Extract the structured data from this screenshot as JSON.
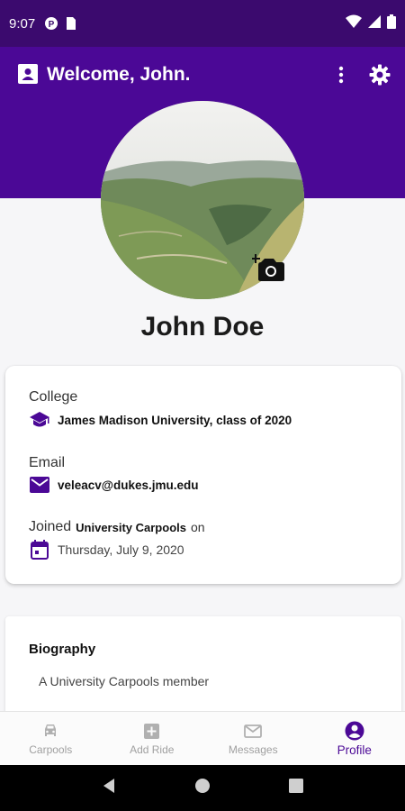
{
  "status_bar": {
    "time": "9:07",
    "icons": [
      "notification-icon",
      "sim-icon",
      "wifi-icon",
      "signal-icon",
      "battery-icon"
    ]
  },
  "header": {
    "title": "Welcome, John.",
    "left_icon": "contact-card-icon",
    "actions": [
      "more-vert-icon",
      "settings-icon"
    ]
  },
  "profile": {
    "name": "John Doe",
    "avatar_icon": "profile-photo",
    "camera_icon": "add-photo-icon"
  },
  "info": {
    "college_label": "College",
    "college_value": "James Madison University, class of 2020",
    "email_label": "Email",
    "email_value": "veleacv@dukes.jmu.edu",
    "joined_prefix": "Joined",
    "joined_org": "University Carpools",
    "joined_suffix": "on",
    "joined_date": "Thursday, July 9, 2020"
  },
  "biography": {
    "title": "Biography",
    "text": "A University Carpools member"
  },
  "bottom_nav": {
    "items": [
      {
        "label": "Carpools",
        "icon": "car-icon",
        "active": false
      },
      {
        "label": "Add Ride",
        "icon": "add-box-icon",
        "active": false
      },
      {
        "label": "Messages",
        "icon": "mail-icon",
        "active": false
      },
      {
        "label": "Profile",
        "icon": "account-circle-icon",
        "active": true
      }
    ]
  },
  "colors": {
    "primary": "#4b0896",
    "status_bar": "#3b0a6e",
    "background": "#f6f6f8"
  }
}
